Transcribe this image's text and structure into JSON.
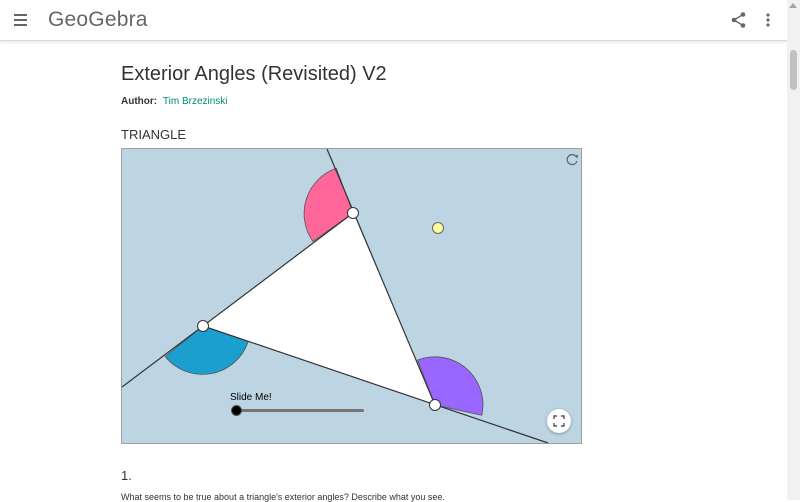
{
  "header": {
    "logo_text": "GeoGebra",
    "icons": {
      "menu": "hamburger-menu-icon",
      "share": "share-icon",
      "more": "more-vert-icon"
    }
  },
  "material": {
    "title": "Exterior Angles (Revisited) V2",
    "author_label": "Author:",
    "author_name": "Tim Brzezinski",
    "section_title": "TRIANGLE"
  },
  "applet": {
    "slider_label": "Slide Me!",
    "slider_value": 0,
    "background_color": "#bdd4e3",
    "exterior_angle_colors": [
      "#ff6699",
      "#1a9fcf",
      "#9966ff"
    ],
    "point_color": "#ffff99",
    "icons": {
      "reset": "refresh-icon",
      "fullscreen": "fullscreen-icon"
    }
  },
  "question": {
    "number": "1.",
    "text": "What seems to be true about a triangle's exterior angles? Describe what you see."
  }
}
